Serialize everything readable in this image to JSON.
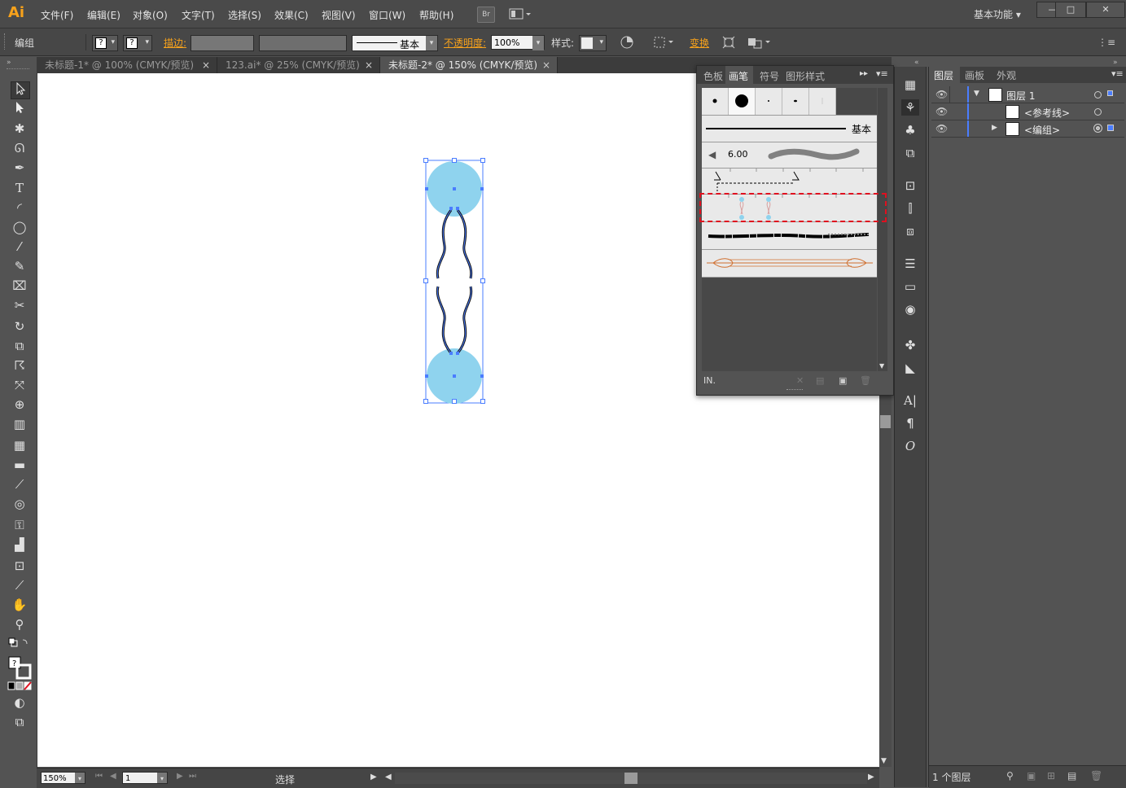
{
  "app": {
    "logo": "Ai",
    "workspace": "基本功能"
  },
  "menu": [
    "文件(F)",
    "编辑(E)",
    "对象(O)",
    "文字(T)",
    "选择(S)",
    "效果(C)",
    "视图(V)",
    "窗口(W)",
    "帮助(H)"
  ],
  "menu_icons": {
    "bridge": "Br",
    "arrange": "arrange-docs-icon"
  },
  "window_controls": {
    "minimize": "—",
    "maximize": "□",
    "close": "✕"
  },
  "control": {
    "selection": "编组",
    "stroke_label": "描边:",
    "stroke_style": "基本",
    "opacity_label": "不透明度:",
    "opacity_value": "100%",
    "style_label": "样式:",
    "transform_label": "变换",
    "unknown_fill": "?",
    "unknown_stroke": "?"
  },
  "tabs": [
    {
      "label": "未标题-1* @ 100% (CMYK/预览)",
      "close": "×"
    },
    {
      "label": "123.ai* @ 25% (CMYK/预览)",
      "close": "×"
    },
    {
      "label": "未标题-2* @ 150% (CMYK/预览)",
      "close": "×"
    }
  ],
  "brush_panel": {
    "tabs": [
      "色板",
      "画笔",
      "符号",
      "图形样式"
    ],
    "active_tab": "画笔",
    "basic_label": "基本",
    "calligraphic_size": "6.00",
    "library_label": "IN.",
    "highlight_color": "#e0101f"
  },
  "layers_panel": {
    "tabs": [
      "图层",
      "画板",
      "外观"
    ],
    "layer_name": "图层 1",
    "sublayers": [
      "<参考线>",
      "<编组>"
    ],
    "footer": "1 个图层"
  },
  "statusbar": {
    "zoom": "150%",
    "artboard": "1",
    "status": "选择"
  },
  "colors": {
    "accent": "#f7a21b",
    "selection_blue": "#4a7dff",
    "circle_fill": "#8fd3ee",
    "highlight": "#e0101f"
  },
  "toolbar_icons": [
    "selection-tool-icon",
    "direct-selection-tool-icon",
    "magic-wand-icon",
    "lasso-icon",
    "pen-tool-icon",
    "type-tool-icon",
    "arc-tool-icon",
    "ellipse-tool-icon",
    "paintbrush-icon",
    "pencil-icon",
    "blob-brush-icon",
    "scissors-icon",
    "rotate-tool-icon",
    "scale-tool-icon",
    "warp-tool-icon",
    "free-transform-icon",
    "shape-builder-icon",
    "perspective-grid-icon",
    "mesh-tool-icon",
    "gradient-tool-icon",
    "eyedropper-icon",
    "blend-tool-icon",
    "symbol-sprayer-icon",
    "column-graph-icon",
    "artboard-tool-icon",
    "slice-tool-icon",
    "hand-tool-icon",
    "zoom-tool-icon"
  ]
}
